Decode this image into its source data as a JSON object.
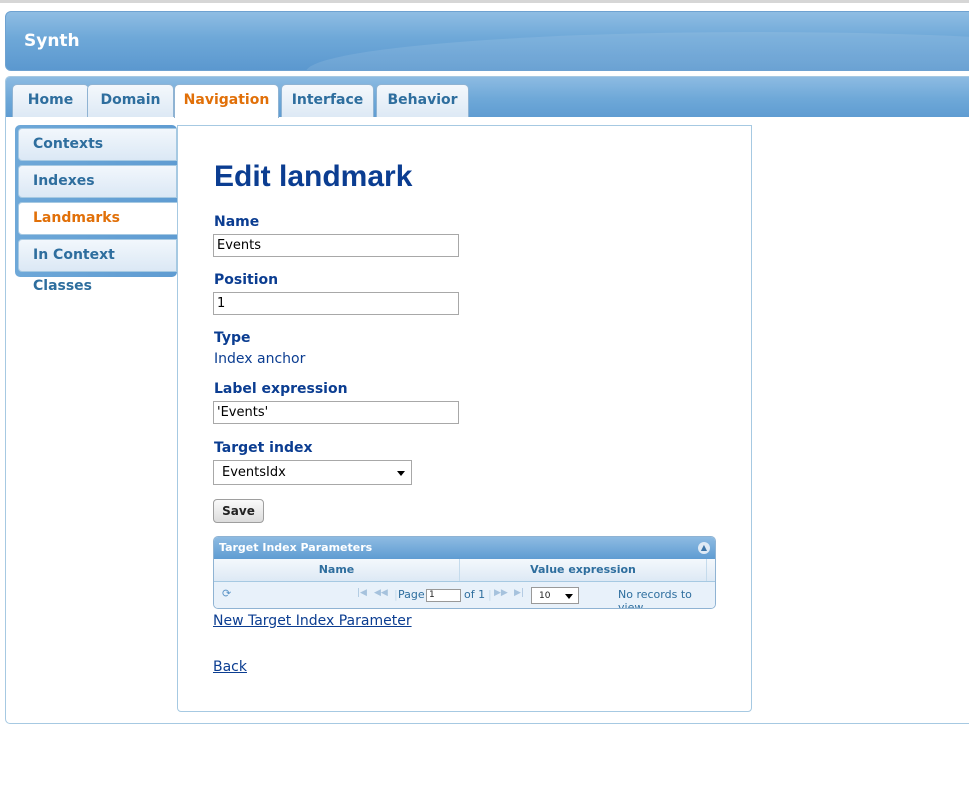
{
  "app": {
    "title": "Synth"
  },
  "tabs": [
    {
      "label": "Home"
    },
    {
      "label": "Domain"
    },
    {
      "label": "Navigation"
    },
    {
      "label": "Interface"
    },
    {
      "label": "Behavior"
    }
  ],
  "sidebar": {
    "items": [
      {
        "label": "Contexts"
      },
      {
        "label": "Indexes"
      },
      {
        "label": "Landmarks"
      },
      {
        "label": "In Context Classes"
      }
    ]
  },
  "form": {
    "title": "Edit landmark",
    "name_label": "Name",
    "name_value": "Events",
    "position_label": "Position",
    "position_value": "1",
    "type_label": "Type",
    "type_value": "Index anchor",
    "label_expr_label": "Label expression",
    "label_expr_value": "'Events'",
    "target_index_label": "Target index",
    "target_index_value": "EventsIdx",
    "save_label": "Save"
  },
  "grid": {
    "caption": "Target Index Parameters",
    "columns": [
      "Name",
      "Value expression"
    ],
    "pager": {
      "page_label": "Page",
      "page_value": "1",
      "of_label": "of 1",
      "rows_per_page": "10",
      "records_text": "No records to view"
    }
  },
  "links": {
    "new_param": "New Target Index Parameter",
    "back": "Back"
  },
  "colors": {
    "accent": "#e17009",
    "title_blue": "#0b3d91",
    "tab_text": "#2e6e9e",
    "header_blue": "#6ea8d8"
  }
}
